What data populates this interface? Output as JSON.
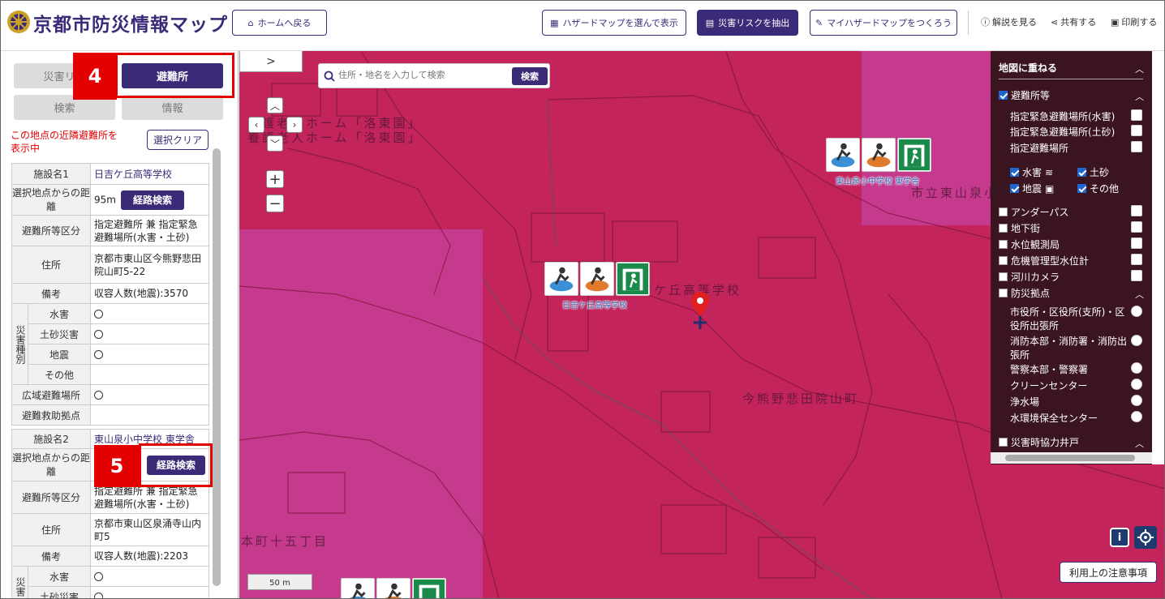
{
  "header": {
    "title": "京都市防災情報マップ",
    "home_button": "ホームへ戻る",
    "hazard_select_button": "ハザードマップを選んで表示",
    "risk_extract_button": "災害リスクを抽出",
    "my_hazard_button": "マイハザードマップをつくろう",
    "help_link": "解説を見る",
    "share_link": "共有する",
    "print_link": "印刷する"
  },
  "sidebar": {
    "tabs": {
      "disaster_risk": "災害リ",
      "shelter": "避難所",
      "search": "検索",
      "info": "情報"
    },
    "annotation_4": "4",
    "annotation_5": "5",
    "nearby_text_line1": "この地点の近隣避難所を",
    "nearby_text_line2": "表示中",
    "clear_button": "選択クリア",
    "facility1": {
      "name_label": "施設名1",
      "name": "日吉ケ丘高等学校",
      "distance_label": "選択地点からの距離",
      "distance": "95m",
      "route_button": "経路検索",
      "category_label": "避難所等区分",
      "category": "指定避難所 兼 指定緊急避難場所(水害・土砂)",
      "address_label": "住所",
      "address": "京都市東山区今熊野悲田院山町5-22",
      "remarks_label": "備考",
      "remarks": "収容人数(地震):3570",
      "disaster_type_label": "災害種別",
      "flood_label": "水害",
      "landslide_label": "土砂災害",
      "earthquake_label": "地震",
      "other_label": "その他",
      "wide_area_label": "広域避難場所",
      "rescue_label": "避難救助拠点"
    },
    "facility2": {
      "name_label": "施設名2",
      "name": "東山泉小中学校 東学舎",
      "distance_label": "選択地点からの距離",
      "route_button": "経路検索",
      "category_label": "避難所等区分",
      "category": "指定避難所 兼 指定緊急避難場所(水害・土砂)",
      "address_label": "住所",
      "address": "京都市東山区泉涌寺山内町5",
      "remarks_label": "備考",
      "remarks": "収容人数(地震):2203",
      "disaster_type_label": "災害",
      "flood_label": "水害",
      "landslide_label": "土砂災害"
    }
  },
  "map": {
    "expand_arrow": ">",
    "search_placeholder": "住所・地名を入力して検索",
    "search_button": "検索",
    "label_facility1": "日吉ケ丘高等学校",
    "label_facility2": "東山泉小中学校 東学舎",
    "map_text_school": "日吉ケ丘高等学校",
    "map_text_town": "今熊野悲田院山町",
    "map_text_nursing": "養護老人ホーム「洛東園」",
    "map_text_city": "市立東山泉小",
    "map_text_hon": "本町十五丁目",
    "scale": "50 m",
    "info_button": "i",
    "notice_button": "利用上の注意事項"
  },
  "layer_panel": {
    "title": "地図に重ねる",
    "shelters": "避難所等",
    "designated_flood": "指定緊急避難場所(水害)",
    "designated_landslide": "指定緊急避難場所(土砂)",
    "designated_shelter": "指定避難場所",
    "filter_flood": "水害",
    "filter_landslide": "土砂",
    "filter_earthquake": "地震",
    "filter_other": "その他",
    "underpass": "アンダーパス",
    "underground": "地下街",
    "water_level_station": "水位観測局",
    "crisis_water_gauge": "危機管理型水位計",
    "river_camera": "河川カメラ",
    "disaster_base": "防災拠点",
    "city_office": "市役所・区役所(支所)・区役所出張所",
    "fire_dept": "消防本部・消防署・消防出張所",
    "police": "警察本部・警察署",
    "clean_center": "クリーンセンター",
    "water_plant": "浄水場",
    "water_env": "水環境保全センター",
    "cooperation_well": "災害時協力井戸"
  },
  "colors": {
    "brand": "#3b2a78",
    "annotation_red": "#e30000",
    "hazard_red": "#c2245b",
    "hazard_magenta": "#c63a8e",
    "layer_panel_bg": "#3a1520"
  }
}
